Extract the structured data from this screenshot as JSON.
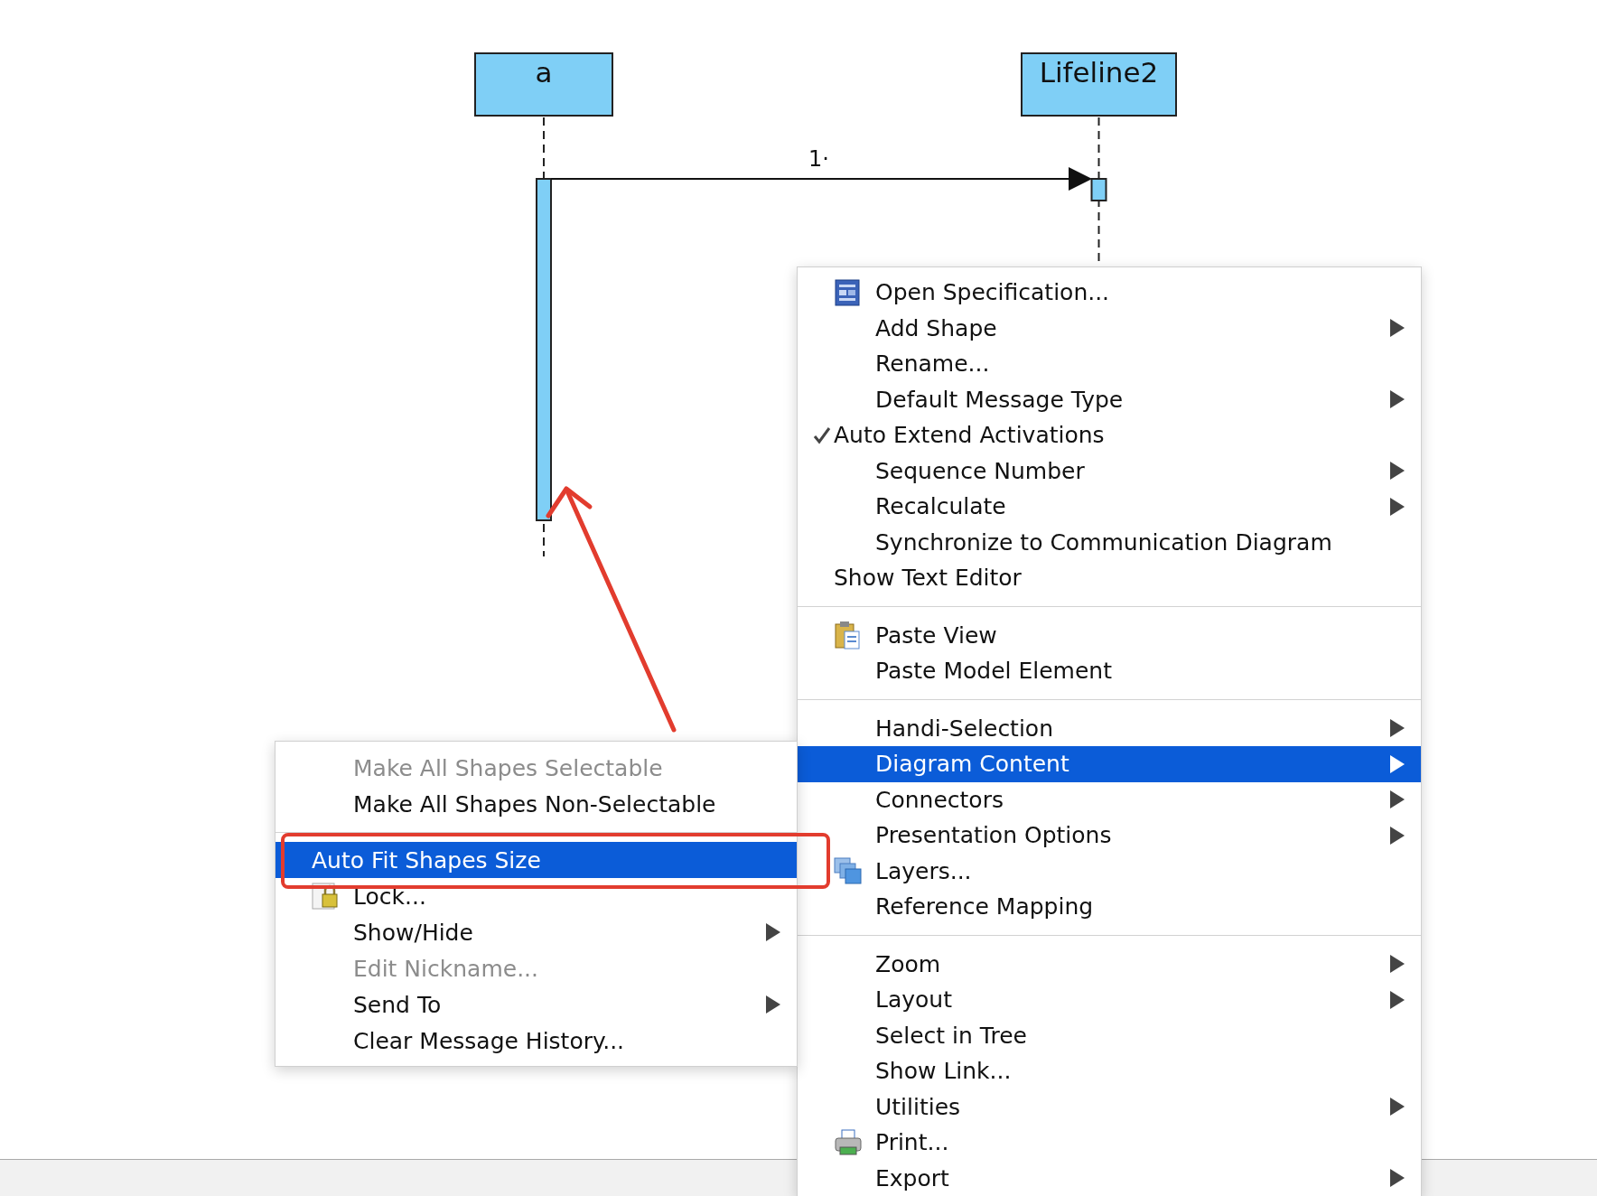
{
  "diagram": {
    "lifelines": [
      {
        "name": "a"
      },
      {
        "name": "Lifeline2"
      }
    ],
    "messages": [
      {
        "label": "1·"
      }
    ]
  },
  "context_menu": {
    "items": [
      {
        "kind": "document",
        "label": "Open Specification...",
        "has_submenu": false,
        "selected": false
      },
      {
        "kind": "item",
        "label": "Add Shape",
        "has_submenu": true,
        "selected": false
      },
      {
        "kind": "item",
        "label": "Rename...",
        "has_submenu": false,
        "selected": false
      },
      {
        "kind": "item",
        "label": "Default Message Type",
        "has_submenu": true,
        "selected": false
      },
      {
        "kind": "check",
        "label": "Auto Extend Activations",
        "checked": true,
        "has_submenu": false,
        "selected": false
      },
      {
        "kind": "item",
        "label": "Sequence Number",
        "has_submenu": true,
        "selected": false
      },
      {
        "kind": "item",
        "label": "Recalculate",
        "has_submenu": true,
        "selected": false
      },
      {
        "kind": "item",
        "label": "Synchronize to Communication Diagram",
        "has_submenu": false,
        "selected": false
      },
      {
        "kind": "check",
        "label": "Show Text Editor",
        "checked": false,
        "has_submenu": false,
        "selected": false
      },
      {
        "kind": "separator"
      },
      {
        "kind": "clipboard",
        "label": "Paste View",
        "has_submenu": false,
        "selected": false
      },
      {
        "kind": "item",
        "label": "Paste Model Element",
        "has_submenu": false,
        "selected": false
      },
      {
        "kind": "separator"
      },
      {
        "kind": "item",
        "label": "Handi-Selection",
        "has_submenu": true,
        "selected": false
      },
      {
        "kind": "item",
        "label": "Diagram Content",
        "has_submenu": true,
        "selected": true
      },
      {
        "kind": "item",
        "label": "Connectors",
        "has_submenu": true,
        "selected": false
      },
      {
        "kind": "item",
        "label": "Presentation Options",
        "has_submenu": true,
        "selected": false
      },
      {
        "kind": "layers",
        "label": "Layers...",
        "has_submenu": false,
        "selected": false
      },
      {
        "kind": "item",
        "label": "Reference Mapping",
        "has_submenu": false,
        "selected": false
      },
      {
        "kind": "separator"
      },
      {
        "kind": "item",
        "label": "Zoom",
        "has_submenu": true,
        "selected": false
      },
      {
        "kind": "item",
        "label": "Layout",
        "has_submenu": true,
        "selected": false
      },
      {
        "kind": "item",
        "label": "Select in Tree",
        "has_submenu": false,
        "selected": false
      },
      {
        "kind": "item",
        "label": "Show Link...",
        "has_submenu": false,
        "selected": false
      },
      {
        "kind": "item",
        "label": "Utilities",
        "has_submenu": true,
        "selected": false
      },
      {
        "kind": "printer",
        "label": "Print...",
        "has_submenu": false,
        "selected": false
      },
      {
        "kind": "item",
        "label": "Export",
        "has_submenu": true,
        "selected": false
      }
    ]
  },
  "submenu": {
    "items": [
      {
        "kind": "item",
        "label": "Make All Shapes Selectable",
        "disabled": true,
        "has_submenu": false,
        "selected": false
      },
      {
        "kind": "item",
        "label": "Make All Shapes Non-Selectable",
        "disabled": false,
        "has_submenu": false,
        "selected": false
      },
      {
        "kind": "separator"
      },
      {
        "kind": "check",
        "label": "Auto Fit Shapes Size",
        "checked": false,
        "disabled": false,
        "has_submenu": false,
        "selected": true
      },
      {
        "kind": "padlock",
        "label": "Lock...",
        "disabled": false,
        "has_submenu": false,
        "selected": false
      },
      {
        "kind": "item",
        "label": "Show/Hide",
        "disabled": false,
        "has_submenu": true,
        "selected": false
      },
      {
        "kind": "item",
        "label": "Edit Nickname...",
        "disabled": true,
        "has_submenu": false,
        "selected": false
      },
      {
        "kind": "item",
        "label": "Send To",
        "disabled": false,
        "has_submenu": true,
        "selected": false
      },
      {
        "kind": "item",
        "label": "Clear Message History...",
        "disabled": false,
        "has_submenu": false,
        "selected": false
      }
    ]
  }
}
